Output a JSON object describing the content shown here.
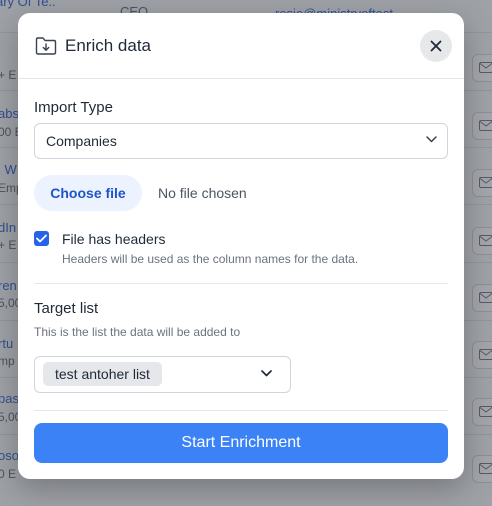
{
  "background": {
    "top_link": "ary Of Te..",
    "top_title": "CEO",
    "top_email": "rosie@ministryoftest",
    "left_fragments": [
      "+ E",
      "abs",
      "00 E",
      "l W",
      "Emp",
      "dIn",
      "+ E",
      "ren",
      "5,00",
      "rtu",
      "mp",
      "pas",
      "5,00",
      "oso",
      "0 E"
    ]
  },
  "modal": {
    "title": "Enrich data",
    "header_icon": "folder-download-icon",
    "close_icon": "close-icon",
    "import_type": {
      "label": "Import Type",
      "selected": "Companies"
    },
    "file": {
      "button_label": "Choose file",
      "status": "No file chosen"
    },
    "headers": {
      "checked": true,
      "label": "File has headers",
      "description": "Headers will be used as the column names for the data."
    },
    "target": {
      "label": "Target list",
      "description": "This is the list the data will be added to",
      "selected_chip": "test antoher list"
    },
    "submit_label": "Start Enrichment"
  },
  "colors": {
    "accent": "#3b82f6",
    "checkbox": "#2563eb",
    "file_button_bg": "#ecf2fe",
    "file_button_text": "#1e55c8"
  }
}
